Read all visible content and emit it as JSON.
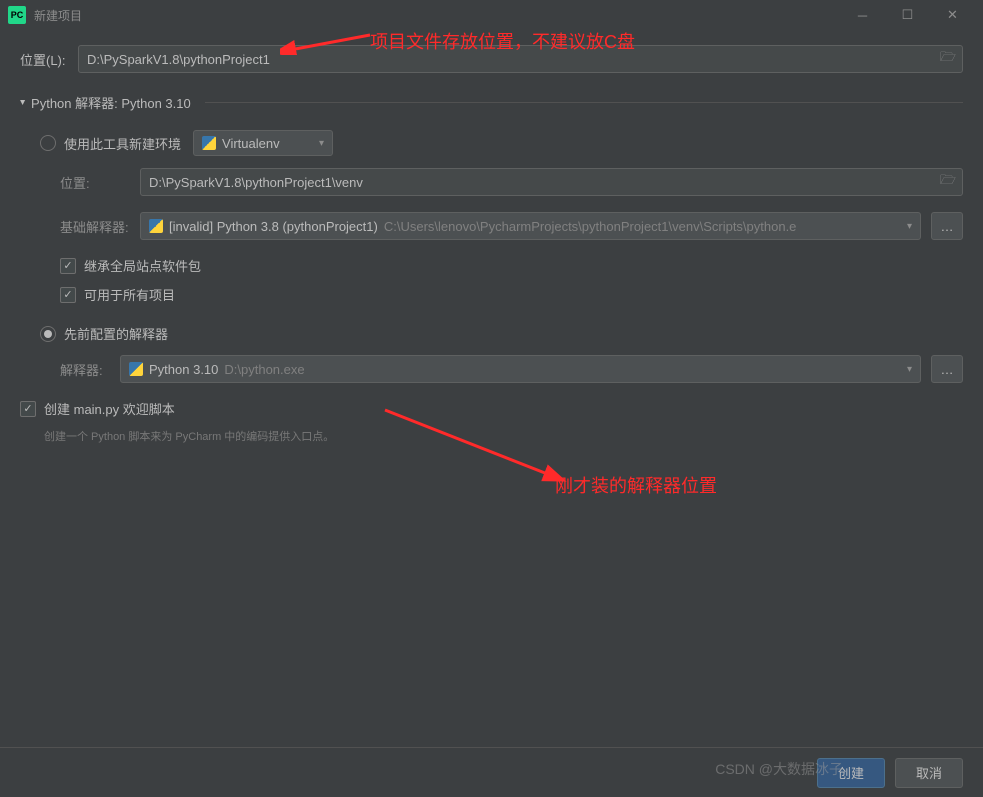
{
  "titlebar": {
    "app_icon_text": "PC",
    "title": "新建项目"
  },
  "location": {
    "label": "位置(L):",
    "value": "D:\\PySparkV1.8\\pythonProject1"
  },
  "interpreter_section": {
    "header": "Python 解释器: Python 3.10"
  },
  "new_env": {
    "radio_label": "使用此工具新建环境",
    "tool_name": "Virtualenv",
    "location_label": "位置:",
    "location_value": "D:\\PySparkV1.8\\pythonProject1\\venv",
    "base_label": "基础解释器:",
    "base_value_prefix": "[invalid] Python 3.8 (pythonProject1)",
    "base_value_path": "C:\\Users\\lenovo\\PycharmProjects\\pythonProject1\\venv\\Scripts\\python.e",
    "inherit_checkbox": "继承全局站点软件包",
    "all_projects_checkbox": "可用于所有项目"
  },
  "existing": {
    "radio_label": "先前配置的解释器",
    "interpreter_label": "解释器:",
    "interpreter_name": "Python 3.10",
    "interpreter_path": "D:\\python.exe"
  },
  "welcome": {
    "checkbox_label": "创建 main.py 欢迎脚本",
    "hint": "创建一个 Python 脚本来为 PyCharm 中的编码提供入口点。"
  },
  "annotations": {
    "top": "项目文件存放位置，不建议放C盘",
    "bottom": "刚才装的解释器位置"
  },
  "footer": {
    "create": "创建",
    "cancel": "取消"
  },
  "watermark": "CSDN @大数据冰子"
}
